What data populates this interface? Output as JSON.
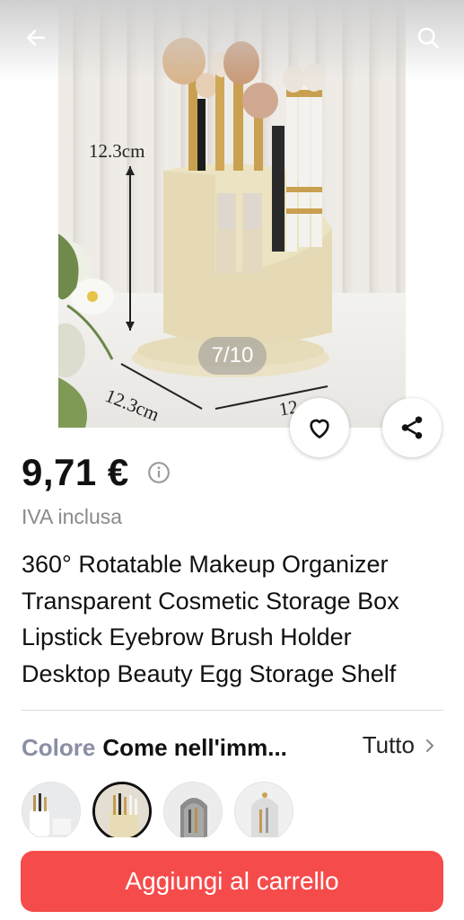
{
  "gallery": {
    "counter": "7/10",
    "dimension_height": "12.3cm",
    "dimension_depth": "12.3cm",
    "dimension_width_partial": "12"
  },
  "product": {
    "price": "9,71 €",
    "vat_note": "IVA inclusa",
    "title": "360° Rotatable Makeup Organizer Transparent Cosmetic Storage Box Lipstick Eyebrow Brush Holder Desktop Beauty Egg Storage Shelf"
  },
  "variant": {
    "label": "Colore",
    "value": "Come nell'imm...",
    "all_label": "Tutto"
  },
  "cart": {
    "button_label": "Aggiungi al carrello"
  },
  "colors": {
    "accent": "#f64b4b",
    "muted_label": "#8a8fa4"
  }
}
